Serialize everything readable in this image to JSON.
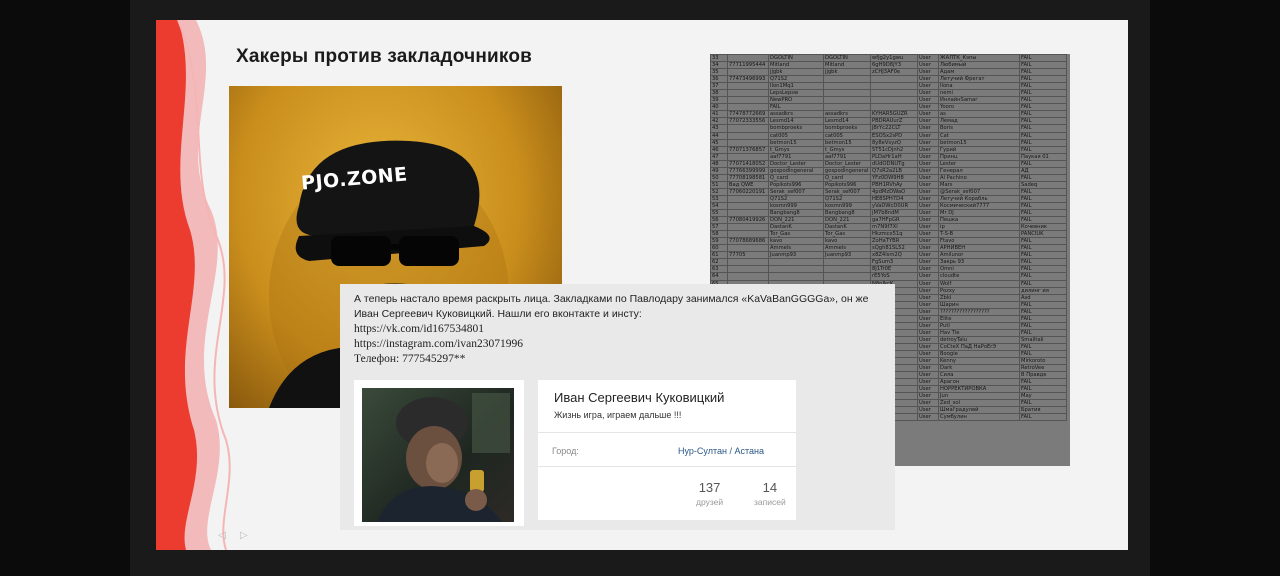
{
  "slide": {
    "title": "Хакеры против закладочников",
    "poster_logo": "PJO.ZONE"
  },
  "post": {
    "line1": "А теперь настало время раскрыть лица. Закладками по Павлодару занимался «KaVaBanGGGGa», он же",
    "line2": "Иван Сергеевич Куковицкий. Нашли его вконтакте и инсту:",
    "vk_link": "https://vk.com/id167534801",
    "insta_link": "https://instagram.com/ivan23071996",
    "phone": "Телефон: 777545297**"
  },
  "profile": {
    "name": "Иван Сергеевич Куковицкий",
    "status": "Жизнь игра, играем дальше !!!",
    "city_label": "Город:",
    "city_value": "Нур-Султан / Астана",
    "friends_count": "137",
    "friends_label": "друзей",
    "posts_count": "14",
    "posts_label": "записей"
  },
  "table_rows": [
    [
      "33",
      "",
      "DGOLTIN",
      "DGOLTIN",
      "wfjg2y1gwu",
      "User",
      "ЖАЛТК_Кэпы",
      "FAIL"
    ],
    [
      "34",
      "77711995444",
      "Mitland",
      "Mitland",
      "6gH9D8jY3",
      "User",
      "Любимый",
      "FAIL"
    ],
    [
      "35",
      "",
      "jjgbk",
      "jjgbk",
      "zCHJ3AF0e",
      "User",
      "Адам",
      "FAIL"
    ],
    [
      "36",
      "77473496993",
      "Q71S2",
      "",
      "",
      "User",
      "Летучий Фрегат",
      "FAIL"
    ],
    [
      "37",
      "",
      "Ilon1Mq1",
      "",
      "",
      "User",
      "Ilona",
      "FAIL"
    ],
    [
      "38",
      "",
      "LepsLepsw",
      "",
      "",
      "User",
      "nemi",
      "FAIL"
    ],
    [
      "39",
      "",
      "NewPRO",
      "",
      "",
      "User",
      "ИнлайнSamar",
      "FAIL"
    ],
    [
      "40",
      "",
      "FAIL",
      "",
      "",
      "User",
      "Yooro",
      "FAIL"
    ],
    [
      "41",
      "77478772669",
      "assadkrs",
      "assadkrs",
      "KYHAR5GUZR",
      "User",
      "as",
      "FAIL"
    ],
    [
      "42",
      "77072333556",
      "Lesmd14",
      "Lesmd14",
      "PBDRAUurZ",
      "User",
      "Лемад",
      "FAIL"
    ],
    [
      "43",
      "",
      "bombproeks",
      "bombproeks",
      "J8rYc22CLT",
      "User",
      "Boris",
      "FAIL"
    ],
    [
      "44",
      "",
      "cat005",
      "cat005",
      "ESOSx2sPD",
      "User",
      "Cat",
      "FAIL"
    ],
    [
      "45",
      "",
      "betmon15",
      "betmon15",
      "8y8eVsyzQ",
      "User",
      "betmon15",
      "FAIL"
    ],
    [
      "46",
      "77071376857",
      "t_Gmys",
      "t_Gmys",
      "5T51cDjnh2",
      "User",
      "Гурий",
      "FAIL"
    ],
    [
      "47",
      "",
      "aaf7791",
      "aaf7791",
      "PLDaHr1aH",
      "User",
      "Принц",
      "Паукая 01"
    ],
    [
      "48",
      "77071418052",
      "Doctor_Lester",
      "Doctor_Lester",
      "dUdODNUTg",
      "User",
      "Lester",
      "FAIL"
    ],
    [
      "49",
      "77766399999",
      "gospodingeneral",
      "gospodingeneral",
      "Q7sR2a2LB",
      "User",
      "Генерал",
      "АД"
    ],
    [
      "50",
      "77708198581",
      "Q_card",
      "Q_card",
      "YFz0DW9H8",
      "User",
      "Al Pachino",
      "FAIL"
    ],
    [
      "51",
      "Вад QWE",
      "Popikots996",
      "Popikots996",
      "PBH1RVhAy",
      "User",
      "Mars",
      "Sadeq"
    ],
    [
      "52",
      "77060220191",
      "Serak_sef007",
      "Serak_sef007",
      "4pdMzDWaO",
      "User",
      "@Serak_sef007",
      "FAIL"
    ],
    [
      "53",
      "",
      "Q71S2",
      "Q71S2",
      "HE8SPH7D4",
      "User",
      "Летучий Корабль",
      "FAIL"
    ],
    [
      "54",
      "",
      "kosmn999",
      "kosmn999",
      "yVaDWcD0UR",
      "User",
      "Космический7777",
      "FAIL"
    ],
    [
      "55",
      "",
      "Bangbang8",
      "Bangbang8",
      "jM7b8ndM",
      "User",
      "Mr DJ",
      "FAIL"
    ],
    [
      "56",
      "77080419926",
      "DON_221",
      "DON_221",
      "ga7HFpGR",
      "User",
      "Пешка",
      "FAIL"
    ],
    [
      "57",
      "",
      "DastanK",
      "DastanK",
      "m7N9f7Xl",
      "User",
      "ip",
      "Кочевник"
    ],
    [
      "58",
      "",
      "Tor_Gas",
      "Tor_Gas",
      "Hkzmcx51q",
      "User",
      "T-S-B",
      "PANCIUK"
    ],
    [
      "59",
      "77078689686",
      "kavo",
      "kavo",
      "ZoHaTYBR",
      "User",
      "Ftavo",
      "FAIL"
    ],
    [
      "60",
      "",
      "Ammels",
      "Ammels",
      "sQgh81SL52",
      "User",
      "АРНИВЕН",
      "FAIL"
    ],
    [
      "61",
      "77705",
      "Juanmp93",
      "Juanmp93",
      "x8Z4lsm2Q",
      "User",
      "Amilunor",
      "FAIL"
    ],
    [
      "62",
      "",
      "",
      "",
      "FgSum3",
      "User",
      "Закрь 93",
      "FAIL"
    ],
    [
      "63",
      "",
      "",
      "",
      "8J1Tr0E",
      "User",
      "Omni",
      "FAIL"
    ],
    [
      "64",
      "",
      "",
      "",
      "rE5YoS",
      "User",
      "cloudte",
      "FAIL"
    ],
    [
      "65",
      "",
      "",
      "",
      "N8nJkcK",
      "User",
      "Wolf",
      "FAIL"
    ],
    [
      "66",
      "",
      "",
      "",
      "QMY7qcf",
      "User",
      "Pozxy",
      "дилинг ия"
    ],
    [
      "67",
      "",
      "",
      "",
      "bNCC5f",
      "User",
      "Zbkl",
      "Asd"
    ],
    [
      "68",
      "",
      "",
      "",
      "FT2gh",
      "User",
      "Шарин",
      "FAIL"
    ],
    [
      "69",
      "",
      "",
      "",
      "G3nbk8",
      "User",
      "??????????????????",
      "FAIL"
    ],
    [
      "70",
      "",
      "",
      "",
      "C9CVbs",
      "User",
      "Elite",
      "FAIL"
    ],
    [
      "71",
      "",
      "",
      "",
      "cSpNA71",
      "User",
      "Putl",
      "FAIL"
    ],
    [
      "72",
      "",
      "",
      "",
      "WJ8hBp",
      "User",
      "Hav Tie",
      "FAIL"
    ],
    [
      "73",
      "",
      "",
      "",
      "eAYNFR",
      "User",
      "detroyTalu",
      "Smalltali"
    ],
    [
      "74",
      "",
      "",
      "",
      "rCRa4Md",
      "User",
      "CoCteX ПаД НаРоЕrЭ",
      "FAIL"
    ],
    [
      "75",
      "",
      "",
      "",
      "tfdgft",
      "User",
      "Boogie",
      "FAIL"
    ],
    [
      "76",
      "",
      "",
      "",
      "mgEkb",
      "User",
      "Kenny",
      "Mirkoroto"
    ],
    [
      "77",
      "",
      "",
      "",
      "8Q9VUT",
      "User",
      "Dark",
      "RetroVee"
    ],
    [
      "78",
      "",
      "",
      "",
      "jkoRA",
      "User",
      "Сила",
      "В Правде"
    ],
    [
      "79",
      "",
      "",
      "",
      "PNKSF",
      "User",
      "Арагон",
      "FAIL"
    ],
    [
      "80",
      "",
      "",
      "",
      "B8wNe",
      "User",
      "НОРРЕКТИРОВКА",
      "FAIL"
    ],
    [
      "81",
      "",
      "",
      "",
      "aTXQ0Z",
      "User",
      "Jun",
      "Мау"
    ],
    [
      "82",
      "",
      "",
      "",
      "nyIIP1",
      "User",
      "Zed_sol",
      "FAIL"
    ],
    [
      "83",
      "",
      "",
      "",
      "6MvR7",
      "User",
      "Шмаl'радулей",
      "Братия"
    ],
    [
      "84",
      "",
      "",
      "",
      "VSQTS",
      "User",
      "Сумбулин",
      "FAIL"
    ]
  ]
}
